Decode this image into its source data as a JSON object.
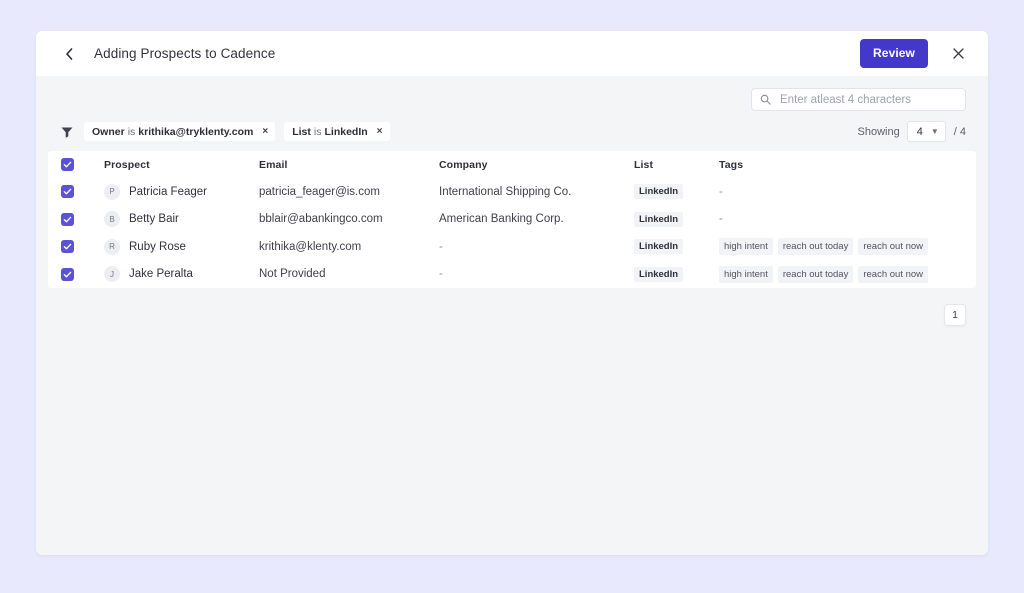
{
  "header": {
    "back_icon": "chevron-left-icon",
    "title": "Adding Prospects to Cadence",
    "review_label": "Review",
    "close_icon": "close-icon"
  },
  "search": {
    "icon": "search-icon",
    "placeholder": "Enter atleast 4 characters",
    "value": ""
  },
  "filters": {
    "icon": "filter-icon",
    "chips": [
      {
        "key": "Owner",
        "operator": "is",
        "value": "krithika@tryklenty.com",
        "remove_icon": "close-icon",
        "remove_label": "×"
      },
      {
        "key": "List",
        "operator": "is",
        "value": "LinkedIn",
        "remove_icon": "close-icon",
        "remove_label": "×"
      }
    ]
  },
  "showing": {
    "label": "Showing",
    "selected": "4",
    "caret_icon": "chevron-down-icon",
    "total": "/ 4"
  },
  "table": {
    "select_all_checked": true,
    "columns": [
      "Prospect",
      "Email",
      "Company",
      "List",
      "Tags"
    ],
    "rows": [
      {
        "checked": true,
        "initial": "P",
        "name": "Patricia Feager",
        "email": "patricia_feager@is.com",
        "company": "International Shipping Co.",
        "list": "LinkedIn",
        "tags": [],
        "tags_empty": "-"
      },
      {
        "checked": true,
        "initial": "B",
        "name": "Betty Bair",
        "email": "bblair@abankingco.com",
        "company": "American Banking Corp.",
        "list": "LinkedIn",
        "tags": [],
        "tags_empty": "-"
      },
      {
        "checked": true,
        "initial": "R",
        "name": "Ruby Rose",
        "email": "krithika@klenty.com",
        "company": "-",
        "list": "LinkedIn",
        "tags": [
          "high intent",
          "reach out today",
          "reach out now"
        ],
        "tags_empty": ""
      },
      {
        "checked": true,
        "initial": "J",
        "name": "Jake Peralta",
        "email": "Not Provided",
        "company": "-",
        "list": "LinkedIn",
        "tags": [
          "high intent",
          "reach out today",
          "reach out now"
        ],
        "tags_empty": ""
      }
    ]
  },
  "pagination": {
    "current_page": "1"
  },
  "colors": {
    "page_background": "#e9e9fd",
    "modal_background": "#f4f5f7",
    "header_background": "#ffffff",
    "accent": "#4338ca",
    "checkbox": "#5b52d6",
    "chip_background": "#f2f3f6"
  }
}
